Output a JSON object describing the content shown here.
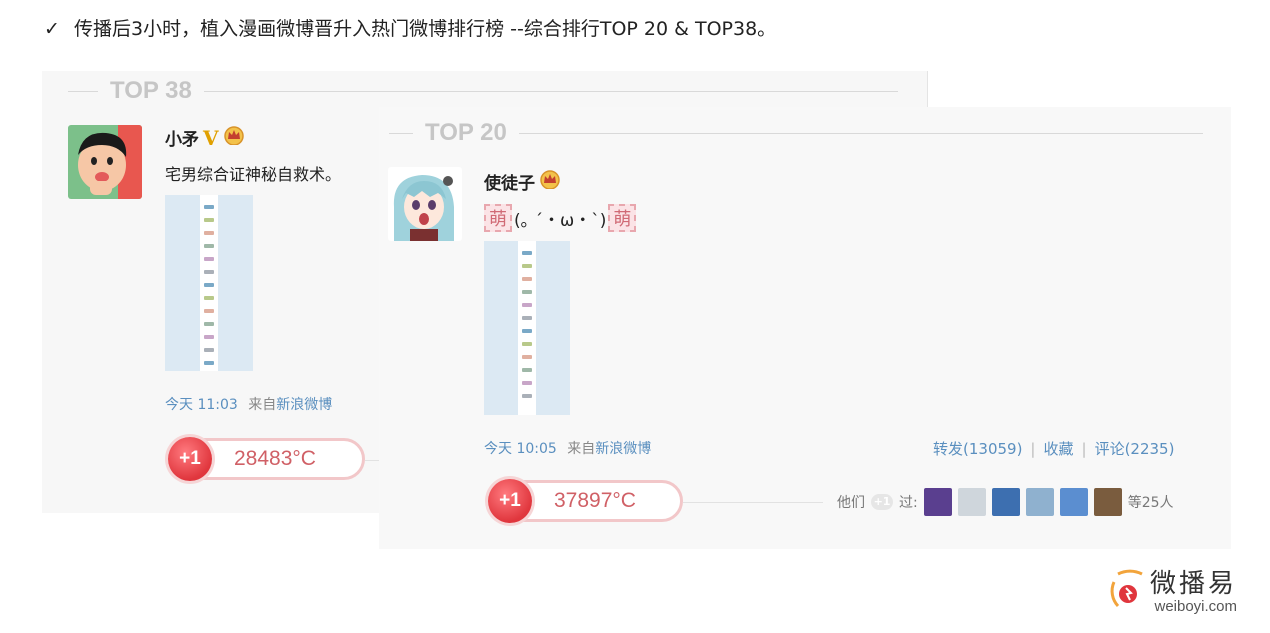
{
  "headline": {
    "check": "✓",
    "text": "传播后3小时，植入漫画微博晋升入热门微博排行榜 --综合排行TOP 20 & TOP38。"
  },
  "top38": {
    "rank_label": "TOP 38",
    "user": "小矛",
    "badge_v": "V",
    "text": "宅男综合证神秘自救术。",
    "time": "今天 11:03",
    "from": "来自",
    "source": "新浪微博",
    "plus": "+1",
    "heat": "28483°C"
  },
  "top20": {
    "rank_label": "TOP 20",
    "user": "使徒子",
    "mood_char": "萌",
    "text": "(｡ ´・ω・`)",
    "time": "今天 10:05",
    "from": "来自",
    "source": "新浪微博",
    "plus": "+1",
    "heat": "37897°C",
    "actions": {
      "repost": "转发(13059)",
      "sep": "|",
      "favorite": "收藏",
      "comment": "评论(2235)"
    },
    "they": {
      "prefix": "他们",
      "plus": "+1",
      "suffix": "过:",
      "count": "等25人"
    }
  },
  "logo": {
    "name": "微播易",
    "domain": "weiboyi.com"
  },
  "colors": {
    "link": "#5a8fbf",
    "heat_red": "#e0363d",
    "rank_gray": "#c6c6c6"
  }
}
